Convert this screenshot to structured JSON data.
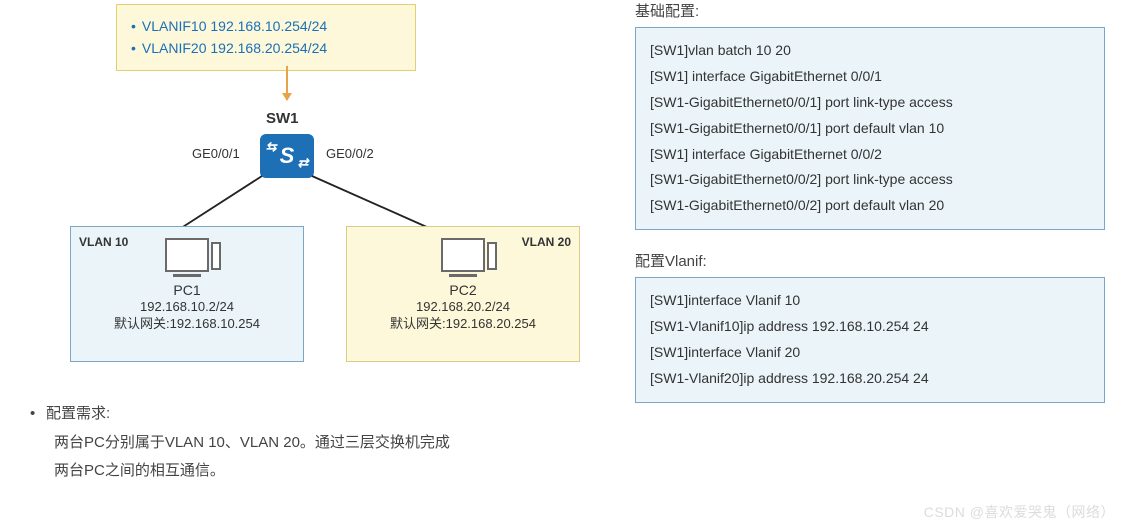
{
  "vlanif": {
    "line1": "VLANIF10 192.168.10.254/24",
    "line2": "VLANIF20 192.168.20.254/24"
  },
  "switch": {
    "name": "SW1",
    "port_left": "GE0/0/1",
    "port_right": "GE0/0/2"
  },
  "pc1": {
    "vlan": "VLAN 10",
    "name": "PC1",
    "ip": "192.168.10.2/24",
    "gw": "默认网关:192.168.10.254"
  },
  "pc2": {
    "vlan": "VLAN 20",
    "name": "PC2",
    "ip": "192.168.20.2/24",
    "gw": "默认网关:192.168.20.254"
  },
  "req": {
    "title": "配置需求:",
    "line1": "两台PC分别属于VLAN 10、VLAN 20。通过三层交换机完成",
    "line2": "两台PC之间的相互通信。"
  },
  "basic_config": {
    "title": "基础配置:",
    "lines": [
      "[SW1]vlan batch 10 20",
      "[SW1] interface GigabitEthernet 0/0/1",
      "[SW1-GigabitEthernet0/0/1] port link-type access",
      "[SW1-GigabitEthernet0/0/1] port default vlan 10",
      "[SW1] interface GigabitEthernet 0/0/2",
      "[SW1-GigabitEthernet0/0/2] port link-type access",
      "[SW1-GigabitEthernet0/0/2] port default vlan 20"
    ]
  },
  "vlanif_config": {
    "title": "配置Vlanif:",
    "lines": [
      "[SW1]interface Vlanif 10",
      "[SW1-Vlanif10]ip address 192.168.10.254 24",
      "[SW1]interface Vlanif 20",
      "[SW1-Vlanif20]ip address 192.168.20.254 24"
    ]
  },
  "watermark": "CSDN @喜欢爱哭鬼（网络）"
}
